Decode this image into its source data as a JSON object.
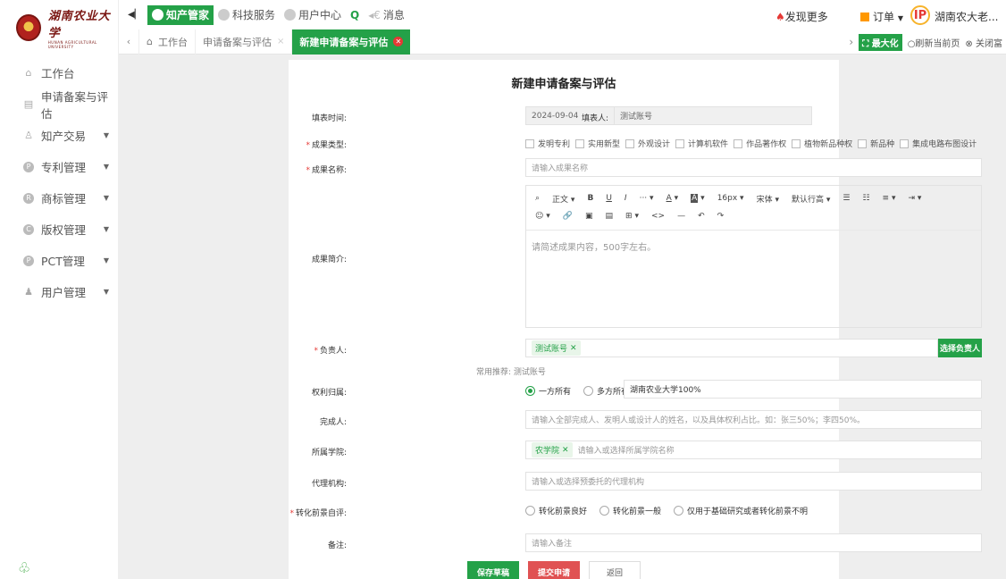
{
  "sidebar": {
    "logo_cn": "湖南农业大学",
    "logo_en": "HUNAN AGRICULTURAL UNIVERSITY",
    "items": [
      {
        "label": "工作台",
        "icon": "home-icon"
      },
      {
        "label": "申请备案与评估",
        "icon": "document-icon"
      },
      {
        "label": "知产交易",
        "icon": "trade-icon",
        "expandable": true
      },
      {
        "label": "专利管理",
        "icon": "patent-icon",
        "expandable": true
      },
      {
        "label": "商标管理",
        "icon": "trademark-icon",
        "expandable": true
      },
      {
        "label": "版权管理",
        "icon": "copyright-icon",
        "expandable": true
      },
      {
        "label": "PCT管理",
        "icon": "pct-icon",
        "expandable": true
      },
      {
        "label": "用户管理",
        "icon": "users-icon",
        "expandable": true
      }
    ]
  },
  "topbar": {
    "items": [
      {
        "label": "知产管家",
        "active": true
      },
      {
        "label": "科技服务"
      },
      {
        "label": "用户中心"
      },
      {
        "label": "消息"
      }
    ],
    "discover": "发现更多",
    "orders": "订单",
    "ip_badge": "IP",
    "user": "湖南农大老..."
  },
  "tabs": {
    "items": [
      {
        "label": "工作台",
        "home": true
      },
      {
        "label": "申请备案与评估",
        "closable": true
      },
      {
        "label": "新建申请备案与评估",
        "active": true,
        "closable": true
      }
    ],
    "maximize": "最大化",
    "refresh": "刷新当前页",
    "close": "关闭富"
  },
  "form": {
    "title": "新建申请备案与评估",
    "fill_time_label": "填表时间:",
    "fill_time_value": "2024-09-04",
    "filler_label": "填表人:",
    "filler_value": "测试账号",
    "type_label": "成果类型:",
    "types": [
      "发明专利",
      "实用新型",
      "外观设计",
      "计算机软件",
      "作品著作权",
      "植物新品种权",
      "新品种",
      "集成电路布图设计"
    ],
    "name_label": "成果名称:",
    "name_placeholder": "请输入成果名称",
    "intro_label": "成果简介:",
    "toolbar_row1": [
      "正文",
      "B",
      "U",
      "I",
      "···",
      "A",
      "A",
      "16px",
      "宋体",
      "默认行高",
      "☰",
      "☷",
      "≡",
      "⇥"
    ],
    "toolbar_row2": [
      "☺",
      "🔗",
      "▣",
      "▤",
      "⊞",
      "<>",
      "—",
      "↶",
      "↷"
    ],
    "intro_placeholder": "请简述成果内容，500字左右。",
    "leader_label": "负责人:",
    "leader_tag": "测试账号",
    "leader_button": "选择负责人",
    "recommend": "常用推荐: 测试账号",
    "ownership_label": "权利归属:",
    "ownership_options": [
      "一方所有",
      "多方所有"
    ],
    "ownership_value": "湖南农业大学100%",
    "completer_label": "完成人:",
    "completer_placeholder": "请输入全部完成人、发明人或设计人的姓名，以及具体权利占比。如：张三50%；李四50%。",
    "college_label": "所属学院:",
    "college_tag": "农学院",
    "college_placeholder": "请输入或选择所属学院名称",
    "agency_label": "代理机构:",
    "agency_placeholder": "请输入或选择预委托的代理机构",
    "prospect_label": "转化前景自评:",
    "prospect_options": [
      "转化前景良好",
      "转化前景一般",
      "仅用于基础研究或者转化前景不明"
    ],
    "remark_label": "备注:",
    "remark_placeholder": "请输入备注",
    "save_button": "保存草稿",
    "submit_button": "提交申请",
    "back_button": "返回"
  }
}
